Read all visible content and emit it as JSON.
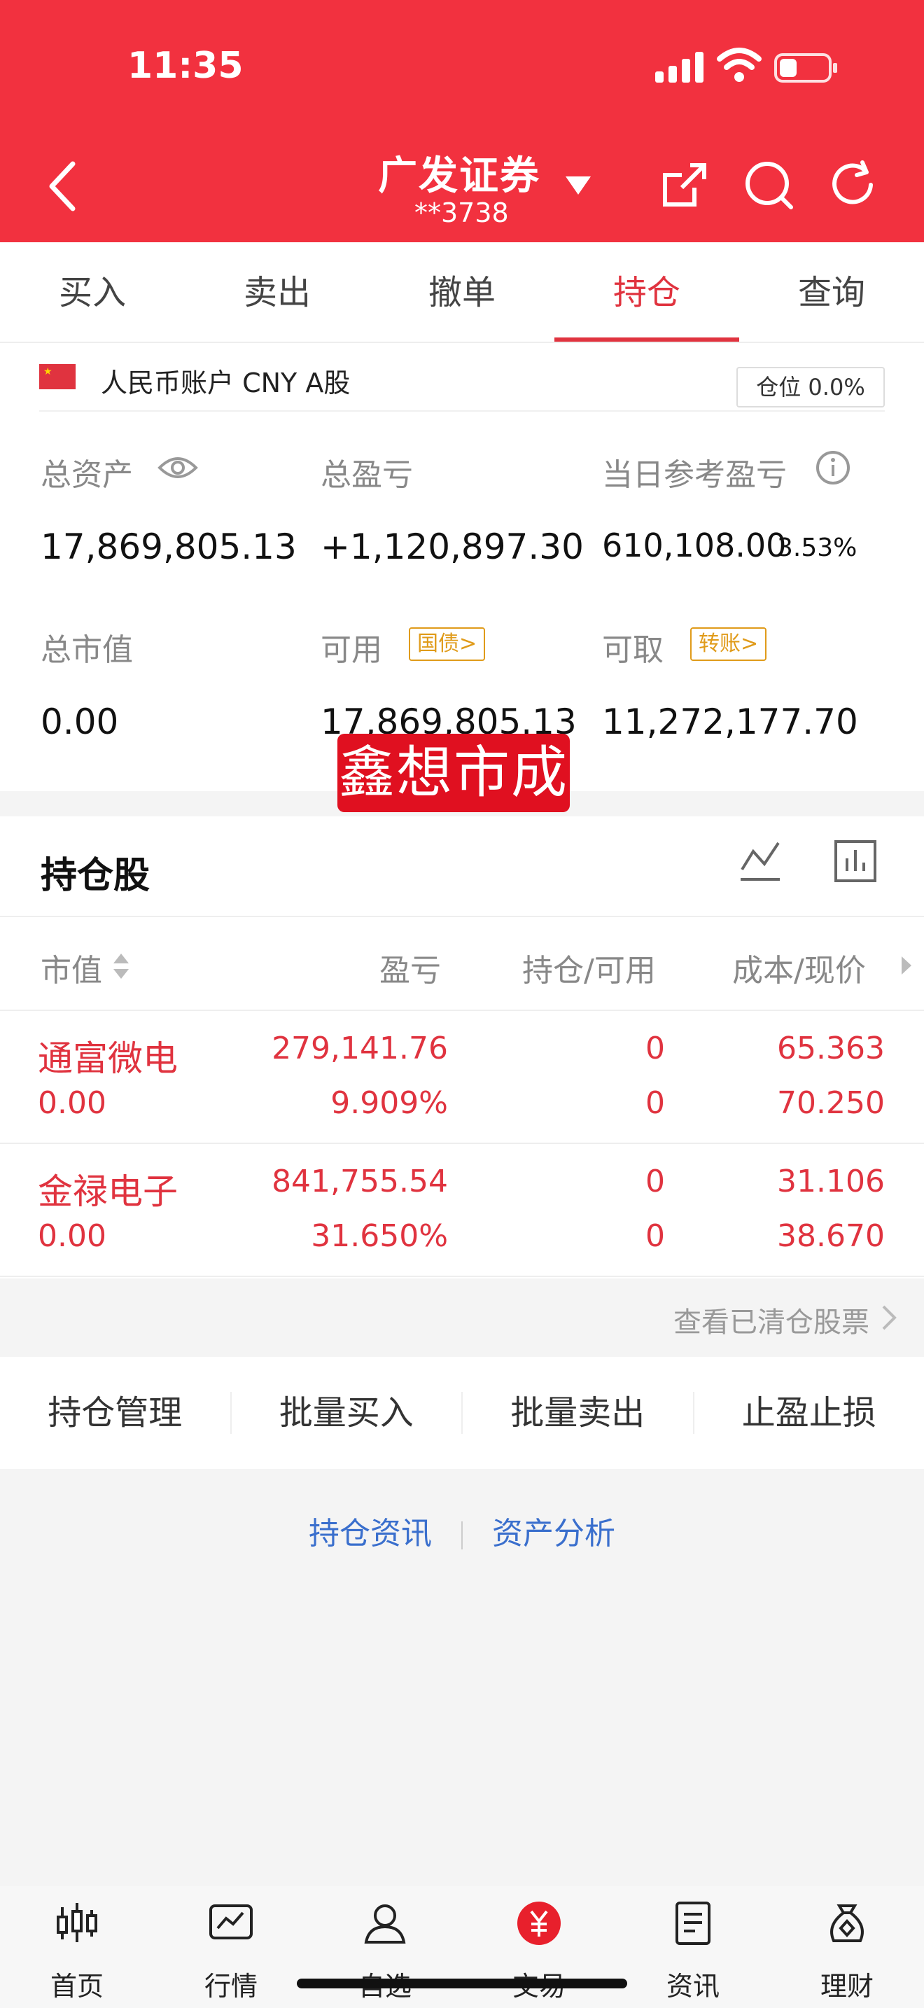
{
  "status": {
    "time": "11:35"
  },
  "header": {
    "broker": "广发证券",
    "account": "**3738"
  },
  "tabs": [
    "买入",
    "卖出",
    "撤单",
    "持仓",
    "查询"
  ],
  "account": {
    "currency": "人民币账户 CNY A股",
    "position_ratio": "仓位 0.0%",
    "total_assets_label": "总资产",
    "total_assets": "17,869,805.13",
    "total_pnl_label": "总盈亏",
    "total_pnl": "+1,120,897.30",
    "daily_pnl_label": "当日参考盈亏",
    "daily_pnl": "610,108.00",
    "daily_pnl_pct": "3.53%",
    "market_value_label": "总市值",
    "market_value": "0.00",
    "available_label": "可用",
    "available_badge": "国债>",
    "available": "17,869,805.13",
    "withdrawable_label": "可取",
    "withdrawable_badge": "转账>",
    "withdrawable": "11,272,177.70"
  },
  "watermark": "鑫想市成",
  "holdings": {
    "title": "持仓股",
    "columns": [
      "市值",
      "盈亏",
      "持仓/可用",
      "成本/现价"
    ],
    "rows": [
      {
        "name": "通富微电",
        "market_value": "0.00",
        "pnl": "279,141.76",
        "pnl_pct": "9.909%",
        "hold": "0",
        "avail": "0",
        "cost": "65.363",
        "price": "70.250"
      },
      {
        "name": "金禄电子",
        "market_value": "0.00",
        "pnl": "841,755.54",
        "pnl_pct": "31.650%",
        "hold": "0",
        "avail": "0",
        "cost": "31.106",
        "price": "38.670"
      }
    ],
    "cleared_link": "查看已清仓股票"
  },
  "actions": [
    "持仓管理",
    "批量买入",
    "批量卖出",
    "止盈止损"
  ],
  "links": [
    "持仓资讯",
    "资产分析"
  ],
  "nav": [
    {
      "label": "首页",
      "icon": "candlestick-icon"
    },
    {
      "label": "行情",
      "icon": "chart-line-icon"
    },
    {
      "label": "自选",
      "icon": "user-icon"
    },
    {
      "label": "交易",
      "icon": "yuan-icon"
    },
    {
      "label": "资讯",
      "icon": "document-icon"
    },
    {
      "label": "理财",
      "icon": "money-bag-icon"
    }
  ],
  "colors": {
    "header": "#f2313f",
    "accent": "#e0333f",
    "badge": "#e09b1a",
    "link": "#3a6fcd"
  }
}
